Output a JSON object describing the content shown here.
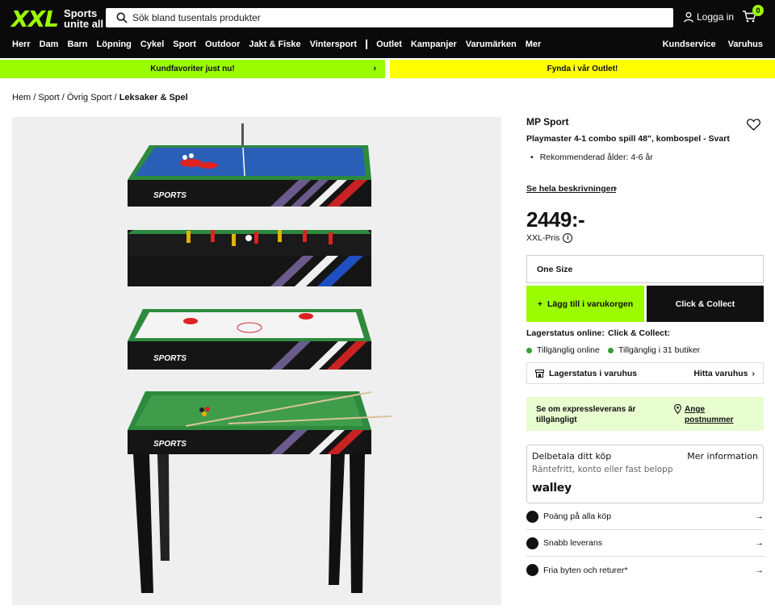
{
  "header": {
    "logo_text": "XXL",
    "tagline": "Sports unite all",
    "search_placeholder": "Sök bland tusentals produkter",
    "login_label": "Logga in",
    "cart_count": "0"
  },
  "nav": {
    "items": [
      "Herr",
      "Dam",
      "Barn",
      "Löpning",
      "Cykel",
      "Sport",
      "Outdoor",
      "Jakt & Fiske",
      "Vintersport"
    ],
    "items2": [
      "Outlet",
      "Kampanjer",
      "Varumärken",
      "Mer"
    ],
    "right": [
      "Kundservice",
      "Varuhus"
    ]
  },
  "promo": {
    "left": "Kundfavoriter just nu!",
    "right": "Fynda i vår Outlet!"
  },
  "breadcrumb": [
    "Hem",
    "Sport",
    "Övrig Sport",
    "Leksaker & Spel"
  ],
  "product": {
    "brand": "MP Sport",
    "title": "Playmaster 4-1 combo spill 48\", kombospel - Svart",
    "bullet": "Rekommenderad ålder: 4-6 år",
    "desc_link": "Se hela beskrivningen",
    "price": "2449:-",
    "price_label": "XXL-Pris",
    "image_brand": "SPORTS",
    "size": "One Size",
    "add_to_cart": "Lägg till i varukorgen",
    "click_collect": "Click & Collect"
  },
  "stock": {
    "online_h": "Lagerstatus online:",
    "cc_h": "Click & Collect:",
    "online_v": "Tillgänglig online",
    "cc_v": "Tillgänglig i 31 butiker",
    "store_label": "Lagerstatus i varuhus",
    "store_link": "Hitta varuhus"
  },
  "express": {
    "text": "Se om expressleverans är tillgängligt",
    "link": "Ange postnummer"
  },
  "walley": {
    "heading": "Delbetala ditt köp",
    "more": "Mer information",
    "sub": "Räntefritt, konto eller fast belopp",
    "logo": "walley"
  },
  "features": [
    "Poäng på alla köp",
    "Snabb leverans",
    "Fria byten och returer*"
  ],
  "colors": {
    "accent": "#9bfb00",
    "yellow": "#ffff00",
    "dark": "#0a0a0a"
  }
}
